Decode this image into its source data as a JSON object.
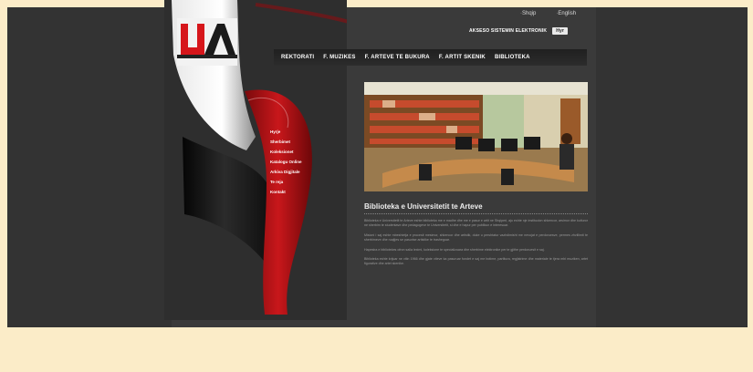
{
  "top_links": [
    "Shqip",
    "English"
  ],
  "login": {
    "label": "AKSESO SISTEMIN ELEKTRONIK",
    "button": "Hyr"
  },
  "nav": {
    "items": [
      "REKTORATI",
      "F. MUZIKES",
      "F. ARTEVE TE BUKURA",
      "F. ARTIT SKENIK",
      "BIBLIOTEKA"
    ]
  },
  "sidebar": {
    "items": [
      "Hyrje",
      "Sherbimet",
      "Koleksionet",
      "Katalogu Online",
      "Arkiva Digjitale",
      "Te reja",
      "Kontakt"
    ]
  },
  "logo": {
    "letters": "UA"
  },
  "content": {
    "title": "Biblioteka e Universitetit te Arteve",
    "paragraphs": [
      "Biblioteka e Universitetit te Arteve eshte biblioteka me e madhe dhe me e pasur e artit ne Shqiperi, ajo eshte nje institucion shkencor, arsimor dhe kulturor ne sherbim te studentave dhe pedagogeve te Universitetit, si dhe e hapur per publikun e interesuar.",
      "Misioni i saj eshte mbeshtetja e procesit mesimor, shkencor dhe artistik, duke u pershtatur vazhdimisht me nevojat e perdoruesve, permes zhvillimit te sherbimeve dhe ruajtjes se pasurise artistike te trasheguar.",
      "Hapesira e bibliotekes ofron salla leximi, koleksione te specializuara dhe sherbime elektronike per te gjithe perdoruesit e saj.",
      "Biblioteka eshte krijuar ne vitin 1966 dhe gjate viteve ka pasuruar fondet e saj me botime, partitura, regjistrime dhe materiale te tjera mbi muziken, artet figurative dhe artet skenike."
    ]
  },
  "colors": {
    "page_bg": "#333333",
    "outer_bg": "#fbecc8",
    "accent_red": "#b01418",
    "text_light": "#eeeeee"
  }
}
